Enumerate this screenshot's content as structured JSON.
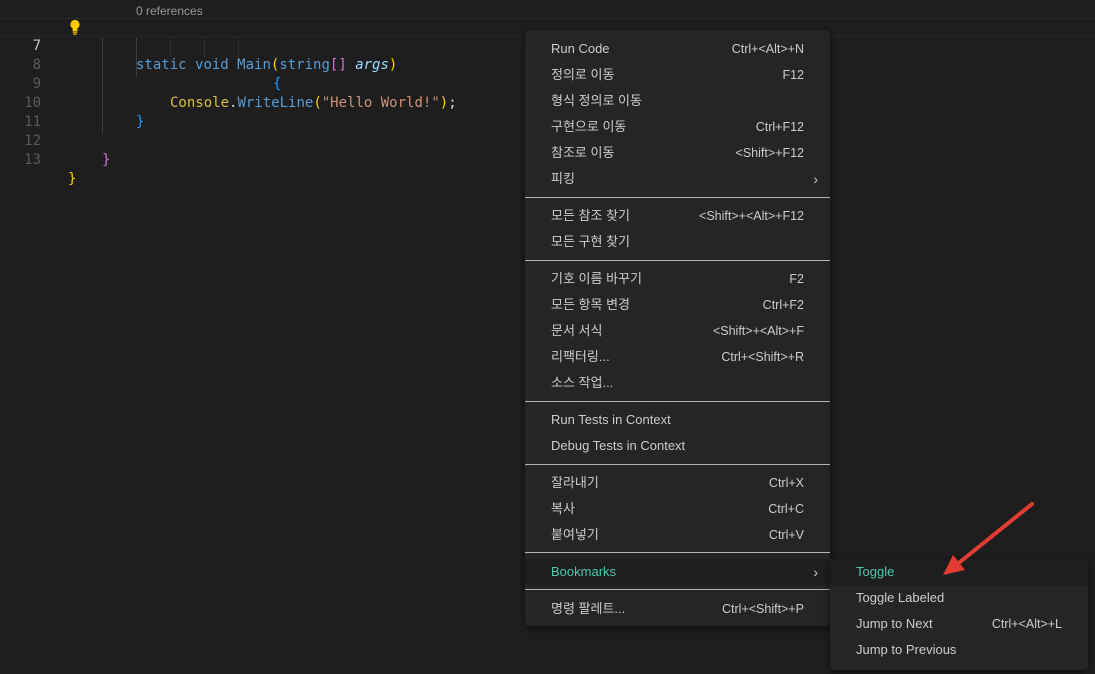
{
  "editor": {
    "codelens": "0 references",
    "lines": [
      {
        "num": "7",
        "active": true
      },
      {
        "num": "8"
      },
      {
        "num": "9"
      },
      {
        "num": "10"
      },
      {
        "num": "11"
      },
      {
        "num": "12"
      },
      {
        "num": "13"
      }
    ],
    "code": {
      "static": "static",
      "void": "void",
      "main": "Main",
      "open_paren": "(",
      "string": "string",
      "brackets": "[]",
      "args": "args",
      "close_paren": ")",
      "open_brace": "{",
      "console": "Console",
      "dot": ".",
      "writeline": "WriteLine",
      "wl_open": "(",
      "hello": "\"Hello World!\"",
      "wl_close": ")",
      "semicolon": ";",
      "close_brace_inner": "}",
      "close_brace_class": "}",
      "close_brace_ns": "}"
    }
  },
  "context_menu": {
    "items": [
      {
        "label": "Run Code",
        "shortcut": "Ctrl+<Alt>+N"
      },
      {
        "label": "정의로 이동",
        "shortcut": "F12"
      },
      {
        "label": "형식 정의로 이동",
        "shortcut": ""
      },
      {
        "label": "구현으로 이동",
        "shortcut": "Ctrl+F12"
      },
      {
        "label": "참조로 이동",
        "shortcut": "<Shift>+F12"
      },
      {
        "label": "피킹",
        "shortcut": "",
        "submenu_glyph": "›"
      },
      {
        "label": "모든 참조 찾기",
        "shortcut": "<Shift>+<Alt>+F12"
      },
      {
        "label": "모든 구현 찾기",
        "shortcut": ""
      },
      {
        "label": "기호 이름 바꾸기",
        "shortcut": "F2"
      },
      {
        "label": "모든 항목 변경",
        "shortcut": "Ctrl+F2"
      },
      {
        "label": "문서 서식",
        "shortcut": "<Shift>+<Alt>+F"
      },
      {
        "label": "리팩터링...",
        "shortcut": "Ctrl+<Shift>+R"
      },
      {
        "label": "소스 작업...",
        "shortcut": ""
      },
      {
        "label": "Run Tests in Context",
        "shortcut": ""
      },
      {
        "label": "Debug Tests in Context",
        "shortcut": ""
      },
      {
        "label": "잘라내기",
        "shortcut": "Ctrl+X"
      },
      {
        "label": "복사",
        "shortcut": "Ctrl+C"
      },
      {
        "label": "붙여넣기",
        "shortcut": "Ctrl+V"
      },
      {
        "label": "Bookmarks",
        "shortcut": "",
        "submenu_glyph": "›"
      },
      {
        "label": "명령 팔레트...",
        "shortcut": "Ctrl+<Shift>+P"
      }
    ]
  },
  "bookmarks_submenu": {
    "items": [
      {
        "label": "Toggle",
        "shortcut": ""
      },
      {
        "label": "Toggle Labeled",
        "shortcut": ""
      },
      {
        "label": "Jump to Next",
        "shortcut": "Ctrl+<Alt>+L"
      },
      {
        "label": "Jump to Previous",
        "shortcut": ""
      }
    ]
  },
  "colors": {
    "background": "#1e1e1e",
    "menu_background": "#252526",
    "menu_text": "#cccccc",
    "highlight_text": "#4ec9b0",
    "annotation_arrow": "#e03c31"
  }
}
